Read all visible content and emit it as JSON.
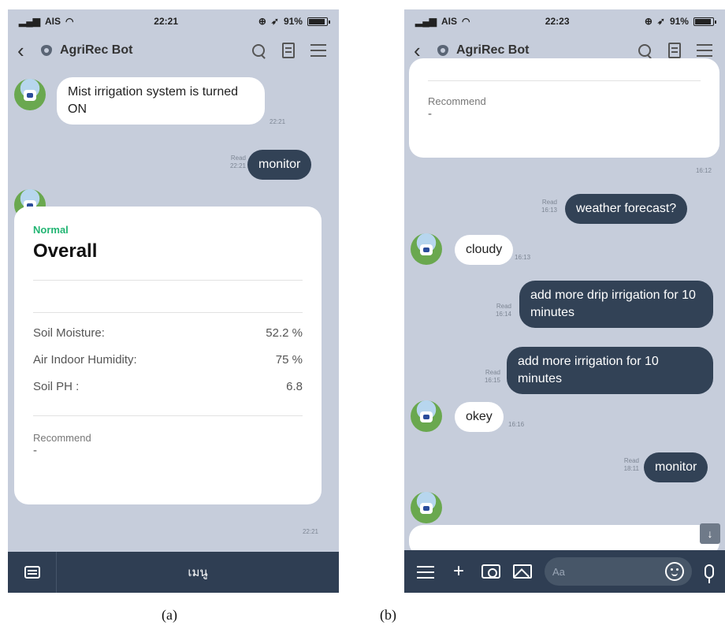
{
  "panel_a": {
    "status": {
      "carrier": "AIS",
      "time": "22:21",
      "battery": "91%"
    },
    "header": {
      "title": "AgriRec Bot"
    },
    "messages": [
      {
        "text": "Mist irrigation system is turned ON",
        "time": "22:21"
      },
      {
        "text": "monitor",
        "read": "Read",
        "time": "22:21"
      }
    ],
    "card": {
      "status": "Normal",
      "title": "Overall",
      "rows": [
        {
          "label": "Soil Moisture:",
          "value": "52.2 %"
        },
        {
          "label": "Air Indoor Humidity:",
          "value": "75 %"
        },
        {
          "label": "Soil PH :",
          "value": "6.8"
        }
      ],
      "recommend_label": "Recommend",
      "recommend_value": "-",
      "time": "22:21"
    },
    "bottom": {
      "menu_label": "เมนู"
    }
  },
  "panel_b": {
    "status": {
      "carrier": "AIS",
      "time": "22:23",
      "battery": "91%"
    },
    "header": {
      "title": "AgriRec Bot"
    },
    "card": {
      "recommend_label": "Recommend",
      "recommend_value": "-",
      "time": "16:12"
    },
    "messages": [
      {
        "text": "weather forecast?",
        "read": "Read",
        "time": "16:13"
      },
      {
        "text": "cloudy",
        "time": "16:13"
      },
      {
        "text": "add more drip irrigation for 10 minutes",
        "read": "Read",
        "time": "16:14"
      },
      {
        "text": "add more irrigation for 10 minutes",
        "read": "Read",
        "time": "16:15"
      },
      {
        "text": "okey",
        "time": "16:16"
      },
      {
        "text": "monitor",
        "read": "Read",
        "time": "18:11"
      }
    ],
    "input_placeholder": "Aa",
    "scroll_icon": "↓"
  },
  "captions": {
    "a": "(a)",
    "b": "(b)"
  }
}
